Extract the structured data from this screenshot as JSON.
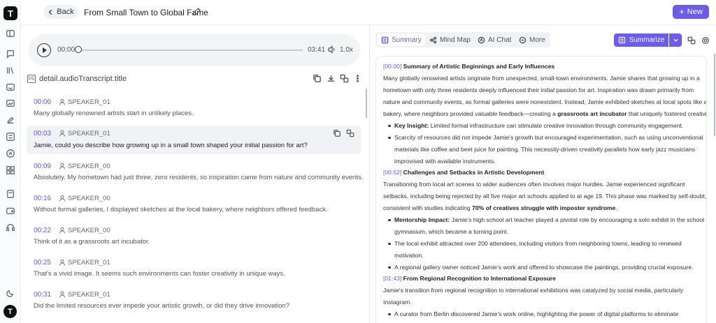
{
  "rail": {
    "logo": "T",
    "avatar": "T"
  },
  "header": {
    "back_label": "Back",
    "title": "From Small Town to Global Fame",
    "new_label": "New"
  },
  "player": {
    "current": "00:00",
    "duration": "03:41",
    "speed": "1.0x",
    "progress": 0.0
  },
  "transcript": {
    "title": "detail.audioTranscript.title",
    "entries": [
      {
        "time": "00:00",
        "speaker": "SPEAKER_01",
        "text": "Many globally renowned artists start in unlikely places."
      },
      {
        "time": "00:03",
        "speaker": "SPEAKER_01",
        "text": "Jamie, could you describe how growing up in a small town shaped your initial passion for art?"
      },
      {
        "time": "00:09",
        "speaker": "SPEAKER_00",
        "text": "Absolutely. My hometown had just three, zero residents, so inspiration came from nature and community events."
      },
      {
        "time": "00:16",
        "speaker": "SPEAKER_00",
        "text": "Without formal galleries, I displayed sketches at the local bakery, where neighbors offered feedback."
      },
      {
        "time": "00:22",
        "speaker": "SPEAKER_00",
        "text": "Think of it as a grassroots art incubator."
      },
      {
        "time": "00:25",
        "speaker": "SPEAKER_01",
        "text": "That's a vivid image. It seems such environments can foster creativity in unique ways."
      },
      {
        "time": "00:31",
        "speaker": "SPEAKER_01",
        "text": "Did the limited resources ever impede your artistic growth, or did they drive innovation?"
      }
    ]
  },
  "tabs": [
    {
      "label": "Summary"
    },
    {
      "label": "Mind Map"
    },
    {
      "label": "AI Chat"
    },
    {
      "label": "More"
    }
  ],
  "summarize_label": "Summarize",
  "summary": {
    "s1": {
      "ts": "[00:00]",
      "heading": "Summary of Artistic Beginnings and Early Influences",
      "p1": "Many globally renowned artists originate from unexpected, small-town environments. Jamie shares that growing up in a",
      "p2": "hometown with only three residents deeply influenced their initial passion for art. Inspiration was drawn primarily from",
      "p3": "nature and community events, as formal galleries were nonexistent. Instead, Jamie exhibited sketches at local spots like a",
      "p4a": "bakery, where neighbors provided valuable feedback—creating a ",
      "p4b": "grassroots art incubator",
      "p4c": " that uniquely fostered creativity.",
      "b1a": "Key Insight:",
      "b1b": " Limited formal infrastructure can stimulate creative innovation through community engagement.",
      "b2a": "Scarcity of resources did not impede Jamie's growth but encouraged experimentation, such as using unconventional",
      "b2b": "materials like coffee and beet juice for painting. This necessity-driven creativity parallels how early jazz musicians",
      "b2c": "improvised with available instruments."
    },
    "s2": {
      "ts": "[00:52]",
      "heading": "Challenges and Setbacks in Artistic Development",
      "p1": "Transitioning from local art scenes to wider audiences often involves major hurdles. Jamie experienced significant",
      "p2": "setbacks, including being rejected by all five major art schools applied to at age 19. This phase was marked by self-doubt,",
      "p3a": "consistent with studies indicating ",
      "p3b": "70% of creatives struggle with imposter syndrome",
      "p3c": ".",
      "b1a": "Mentorship Impact:",
      "b1b": " Jamie's high school art teacher played a pivotal role by encouraging a solo exhibit in the school",
      "b1c": "gymnasium, which became a turning point.",
      "b2a": "The local exhibit attracted over 200 attendees, including visitors from neighboring towns, leading to renewed",
      "b2b": "motivation.",
      "b3": "A regional gallery owner noticed Jamie's work and offered to showcase the paintings, providing crucial exposure."
    },
    "s3": {
      "ts": "[01:43]",
      "heading": "From Regional Recognition to International Exposure",
      "p1": "Jamie's transition from regional recognition to international exhibitions was catalyzed by social media, particularly",
      "p2": "Instagram.",
      "b1": "A curator from Berlin discovered Jamie's work online, highlighting the power of digital platforms to eliminate"
    }
  }
}
